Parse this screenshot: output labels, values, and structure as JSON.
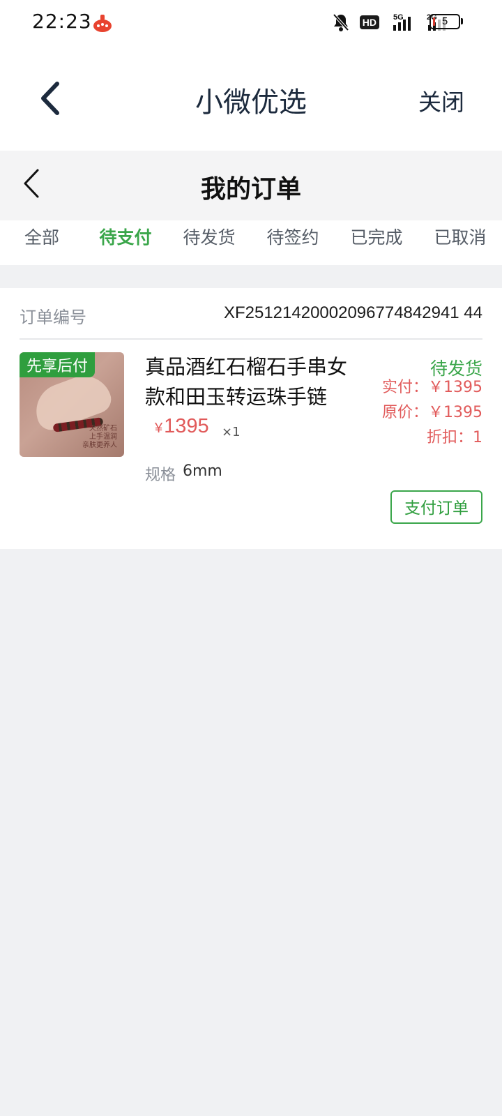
{
  "status_bar": {
    "time": "22:23",
    "network_hd": "HD",
    "network_5g": "5G",
    "network_2g": "2G",
    "battery": "5"
  },
  "topbar": {
    "title": "小微优选",
    "close_label": "关闭"
  },
  "subheader": {
    "title": "我的订单"
  },
  "tabs": [
    {
      "label": "全部"
    },
    {
      "label": "待支付"
    },
    {
      "label": "待发货"
    },
    {
      "label": "待签约"
    },
    {
      "label": "已完成"
    },
    {
      "label": "已取消"
    }
  ],
  "active_tab": "待支付",
  "order": {
    "number_label": "订单编号",
    "number": "XF25121420002096774842941 44",
    "badge": "先享后付",
    "image_text": [
      "天然矿石",
      "上手温润",
      "亲肤更养人"
    ],
    "title": "真品酒红石榴石手串女款和田玉转运珠手链",
    "price_symbol": "¥",
    "price": "1395",
    "quantity": "×1",
    "spec_label": "规格",
    "spec_value": "6mm",
    "status": "待发货",
    "paid": "实付：￥1395",
    "original": "原价：￥1395",
    "discount": "折扣：1",
    "pay_button": "支付订单"
  },
  "colors": {
    "accent_green": "#3aa64a",
    "price_red": "#e15a5a",
    "title_navy": "#1c2a3d"
  }
}
